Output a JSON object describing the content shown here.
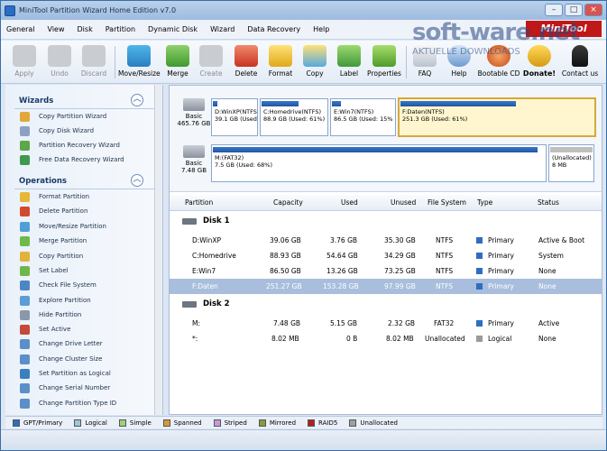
{
  "window": {
    "title": "MiniTool Partition Wizard Home Edition v7.0",
    "logo": "MiniTool"
  },
  "watermark": {
    "text": "soft-ware.net",
    "sub": "AKTUELLE DOWNLOADS"
  },
  "menu": [
    "General",
    "View",
    "Disk",
    "Partition",
    "Dynamic Disk",
    "Wizard",
    "Data Recovery",
    "Help"
  ],
  "toolbar": {
    "apply": "Apply",
    "undo": "Undo",
    "discard": "Discard",
    "move_resize": "Move/Resize",
    "merge": "Merge",
    "create": "Create",
    "delete": "Delete",
    "format": "Format",
    "copy": "Copy",
    "label": "Label",
    "properties": "Properties",
    "faq": "FAQ",
    "help": "Help",
    "bootable_cd": "Bootable CD",
    "donate": "Donate!",
    "contact": "Contact us"
  },
  "wizards": {
    "title": "Wizards",
    "items": [
      "Copy Partition Wizard",
      "Copy Disk Wizard",
      "Partition Recovery Wizard",
      "Free Data Recovery Wizard"
    ]
  },
  "operations": {
    "title": "Operations",
    "items": [
      "Format Partition",
      "Delete Partition",
      "Move/Resize Partition",
      "Merge Partition",
      "Copy Partition",
      "Set Label",
      "Check File System",
      "Explore Partition",
      "Hide Partition",
      "Set Active",
      "Change Drive Letter",
      "Change Cluster Size",
      "Set Partition as Logical",
      "Change Serial Number",
      "Change Partition Type ID"
    ]
  },
  "diskmap": {
    "disk1": {
      "type": "Basic",
      "size": "465.76 GB",
      "parts": [
        {
          "name": "D:WinXP(NTFS",
          "info": "39.1 GB (Used"
        },
        {
          "name": "C:Homedrive(NTFS)",
          "info": "88.9 GB (Used: 61%)"
        },
        {
          "name": "E:Win7(NTFS)",
          "info": "86.5 GB (Used: 15%"
        },
        {
          "name": "F:Daten(NTFS)",
          "info": "251.3 GB (Used: 61%)"
        }
      ]
    },
    "disk2": {
      "type": "Basic",
      "size": "7.48 GB",
      "parts": [
        {
          "name": "M:(FAT32)",
          "info": "7.5 GB (Used: 68%)"
        },
        {
          "name": "(Unallocated)",
          "info": "8 MB"
        }
      ]
    }
  },
  "table": {
    "headers": [
      "Partition",
      "Capacity",
      "Used",
      "Unused",
      "File System",
      "Type",
      "Status"
    ],
    "disk1_title": "Disk 1",
    "disk2_title": "Disk 2",
    "rows1": [
      [
        "D:WinXP",
        "39.06 GB",
        "3.76 GB",
        "35.30 GB",
        "NTFS",
        "Primary",
        "Active & Boot"
      ],
      [
        "C:Homedrive",
        "88.93 GB",
        "54.64 GB",
        "34.29 GB",
        "NTFS",
        "Primary",
        "System"
      ],
      [
        "E:Win7",
        "86.50 GB",
        "13.26 GB",
        "73.25 GB",
        "NTFS",
        "Primary",
        "None"
      ],
      [
        "F:Daten",
        "251.27 GB",
        "153.28 GB",
        "97.99 GB",
        "NTFS",
        "Primary",
        "None"
      ]
    ],
    "rows2": [
      [
        "M:",
        "7.48 GB",
        "5.15 GB",
        "2.32 GB",
        "FAT32",
        "Primary",
        "Active"
      ],
      [
        "*:",
        "8.02 MB",
        "0 B",
        "8.02 MB",
        "Unallocated",
        "Logical",
        "None"
      ]
    ]
  },
  "legend": [
    {
      "label": "GPT/Primary",
      "color": "#2e6ec0"
    },
    {
      "label": "Logical",
      "color": "#9ec6d6"
    },
    {
      "label": "Simple",
      "color": "#9fd07a"
    },
    {
      "label": "Spanned",
      "color": "#d49a3c"
    },
    {
      "label": "Striped",
      "color": "#c89ad8"
    },
    {
      "label": "Mirrored",
      "color": "#8a9a3a"
    },
    {
      "label": "RAID5",
      "color": "#b02020"
    },
    {
      "label": "Unallocated",
      "color": "#a0a0a0"
    }
  ]
}
